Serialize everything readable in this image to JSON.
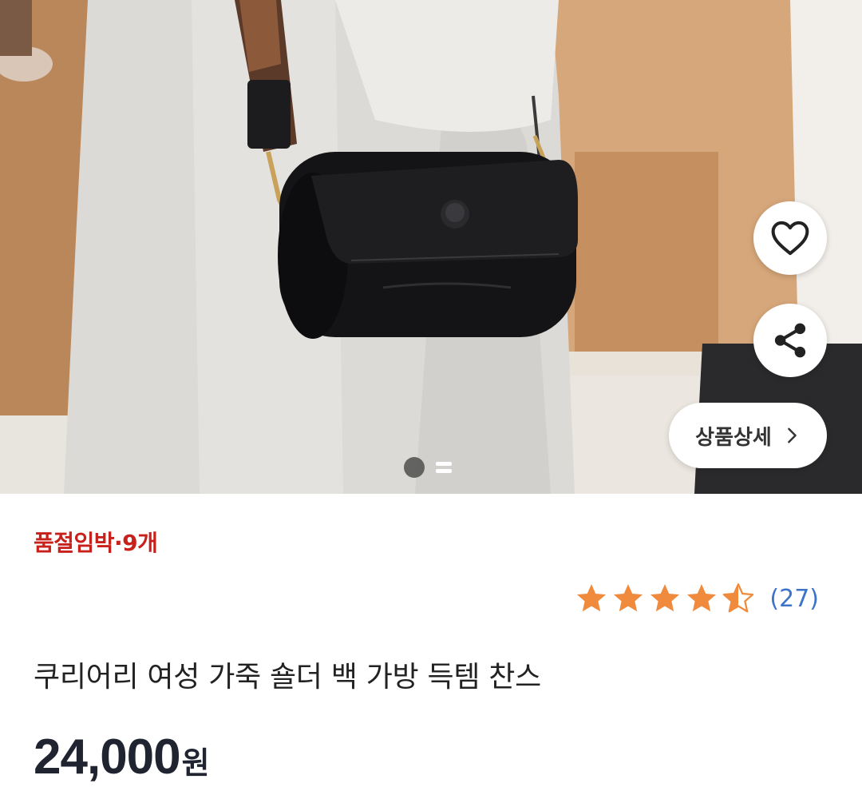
{
  "product_image": {
    "alt": "black leather cylinder shoulder bag"
  },
  "actions": {
    "like_icon": "heart-icon",
    "share_icon": "share-icon",
    "detail_label": "상품상세",
    "detail_chevron": "chevron-right-icon"
  },
  "stock_badge": "품절임박·9개",
  "rating": {
    "value": 4.5,
    "max": 5,
    "review_count": "(27)",
    "star_color": "#f08a3c"
  },
  "product": {
    "title": "쿠리어리 여성 가죽 숄더 백 가방 득템 찬스",
    "price": "24,000",
    "currency": "원"
  },
  "colors": {
    "stock_red": "#c8211c",
    "review_blue": "#3d74c9"
  }
}
